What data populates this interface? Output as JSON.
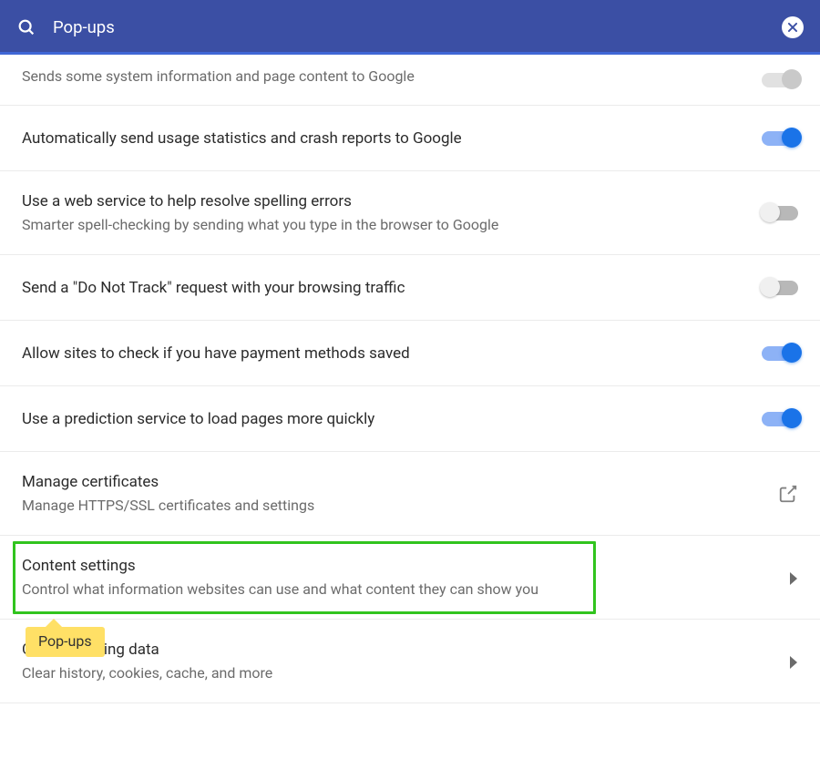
{
  "header": {
    "title": "Pop-ups"
  },
  "rows": [
    {
      "id": "system-info",
      "title": "",
      "sub": "Sends some system information and page content to Google",
      "control": "toggle-partial",
      "state": "off"
    },
    {
      "id": "usage-stats",
      "title": "Automatically send usage statistics and crash reports to Google",
      "sub": "",
      "control": "toggle",
      "state": "on"
    },
    {
      "id": "spelling",
      "title": "Use a web service to help resolve spelling errors",
      "sub": "Smarter spell-checking by sending what you type in the browser to Google",
      "control": "toggle",
      "state": "off"
    },
    {
      "id": "dnt",
      "title": "Send a \"Do Not Track\" request with your browsing traffic",
      "sub": "",
      "control": "toggle",
      "state": "off"
    },
    {
      "id": "payment",
      "title": "Allow sites to check if you have payment methods saved",
      "sub": "",
      "control": "toggle",
      "state": "on"
    },
    {
      "id": "prediction",
      "title": "Use a prediction service to load pages more quickly",
      "sub": "",
      "control": "toggle",
      "state": "on"
    },
    {
      "id": "certificates",
      "title": "Manage certificates",
      "sub": "Manage HTTPS/SSL certificates and settings",
      "control": "external",
      "state": ""
    },
    {
      "id": "content-settings",
      "title": "Content settings",
      "sub": "Control what information websites can use and what content they can show you",
      "control": "chevron",
      "state": ""
    },
    {
      "id": "clear-data",
      "title": "Clear browsing data",
      "sub": "Clear history, cookies, cache, and more",
      "control": "chevron",
      "state": ""
    }
  ],
  "callout": {
    "text": "Pop-ups"
  },
  "colors": {
    "accent": "#1a73e8",
    "header": "#3b4fa4",
    "highlight": "#31c41e",
    "callout": "#ffe066"
  }
}
